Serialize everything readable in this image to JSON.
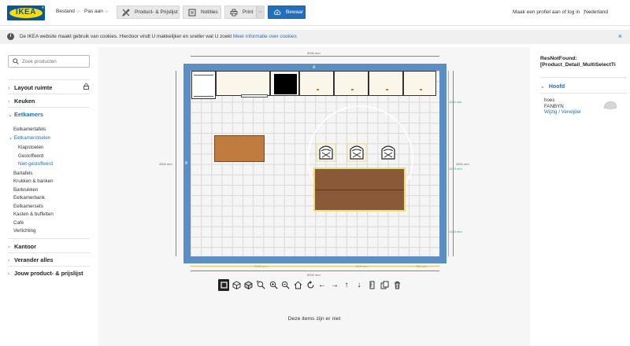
{
  "brand": {
    "logo_text": "IKEA",
    "reg_mark": "®"
  },
  "topbar": {
    "menu": [
      {
        "label": "Bestand"
      },
      {
        "label": "Pas aan"
      }
    ],
    "buttons": {
      "product_label": "Product- & Prijslijst",
      "notes_label": "Notities",
      "print_label": "Print",
      "save_label": "Bewaar"
    },
    "profile_link": "Maak een profiel aan of log in",
    "country": "Nederland"
  },
  "cookie": {
    "message": "De IKEA website maakt gebruik van cookies. Hierdoor vindt U makkelijker en sneller wat U zoekt",
    "link": "Meer informatie over cookies",
    "close": "×"
  },
  "sidebar": {
    "search_placeholder": "Zoek producten",
    "sections": [
      {
        "label": "Layout ruimte",
        "locked": true
      },
      {
        "label": "Keuken"
      },
      {
        "label": "Eetkamers",
        "open": true
      },
      {
        "label": "Kantoor"
      },
      {
        "label": "Verander alles"
      },
      {
        "label": "Jouw product- & prijslijst"
      }
    ],
    "eetkamers_items": [
      "Eetkamertafels",
      "Eetkamerstoelen",
      "Klapstoelen",
      "Gestoffeerd",
      "Niet-gestoffeerd",
      "Bartafels",
      "Krukken & banken",
      "Barkrukken",
      "Eetkamerbank",
      "Eetkamersets",
      "Kasten & buffetten",
      "Café",
      "Verlichting"
    ]
  },
  "canvas": {
    "dim_top": "6000 mm",
    "dim_bottom": "6000 mm",
    "dim_left": "4500 mm",
    "dim_right": "4500 mm",
    "wall_top": "A",
    "wall_left": "B",
    "dim_bottom_seg1": "2050 mm",
    "dim_bottom_seg2": "1200 mm",
    "dim_bottom_seg3": "785 mm",
    "dim_right_seg1": "1126 mm",
    "dim_right_seg2": "1675 mm",
    "dim_right_seg3": "1320 mm",
    "not_there": "Deze items zijn er niet"
  },
  "tools": [
    {
      "name": "select-tool-icon"
    },
    {
      "name": "view-3d-icon"
    },
    {
      "name": "cube-icon"
    },
    {
      "name": "zoom-fit-icon"
    },
    {
      "name": "zoom-in-icon"
    },
    {
      "name": "zoom-out-icon"
    },
    {
      "name": "home-icon"
    },
    {
      "name": "rotate-icon"
    },
    {
      "name": "arrow-left-icon"
    },
    {
      "name": "arrow-right-icon"
    },
    {
      "name": "arrow-up-icon"
    },
    {
      "name": "arrow-down-icon"
    },
    {
      "name": "measure-icon"
    },
    {
      "name": "copy-icon"
    },
    {
      "name": "delete-icon"
    }
  ],
  "right_panel": {
    "title_line1": "ResNotFound:",
    "title_line2": "[Product_Detail_MultiSelectTi",
    "group_label": "Hoofd",
    "item_name": "hoes",
    "item_series": "FANBYN",
    "item_actions": "Wijzig / Verwijder"
  },
  "colors": {
    "accent": "#1f6fbe",
    "wall": "#5b8ec4",
    "table_light": "#c07c3f",
    "table_dark": "#8a5a38"
  }
}
